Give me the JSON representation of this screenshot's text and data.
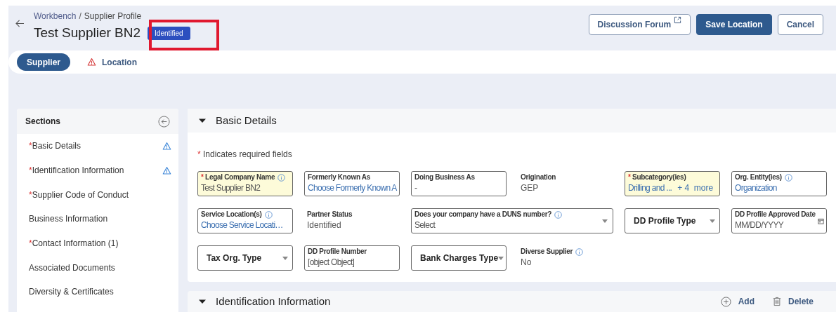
{
  "required_mark": "*",
  "breadcrumb_separator": "/",
  "breadcrumb": [
    {
      "label": "Workbench",
      "link": true
    },
    {
      "label": "Supplier Profile",
      "link": false
    }
  ],
  "title": "Test Supplier BN2",
  "status_badge": "Identified",
  "actions": [
    {
      "label": "Discussion Forum",
      "kind": "external"
    },
    {
      "label": "Save Location",
      "kind": "primary"
    },
    {
      "label": "Cancel",
      "kind": "secondary"
    }
  ],
  "tabs": [
    {
      "label": "Supplier",
      "selected": true,
      "warning": false
    },
    {
      "label": "Location",
      "selected": false,
      "warning": true
    }
  ],
  "sidebar": {
    "title": "Sections",
    "items": [
      {
        "label": "Basic Details",
        "required": true,
        "warning": true
      },
      {
        "label": "Identification Information",
        "required": true,
        "warning": true
      },
      {
        "label": "Supplier Code of Conduct",
        "required": true,
        "warning": false
      },
      {
        "label": "Business Information",
        "required": false,
        "warning": false
      },
      {
        "label": "Contact Information (1)",
        "required": true,
        "warning": false
      },
      {
        "label": "Associated Documents",
        "required": false,
        "warning": false
      },
      {
        "label": "Diversity & Certificates",
        "required": false,
        "warning": false
      }
    ]
  },
  "sections": [
    {
      "title": "Basic Details",
      "expanded": true,
      "required_note": "Indicates required fields",
      "rows": [
        [
          {
            "kind": "text",
            "label": "Legal Company Name",
            "value": "Test Supplier BN2",
            "required": true,
            "highlighted": true,
            "info": true
          },
          {
            "kind": "lookup",
            "label": "Formerly Known As",
            "value": "Choose Formerly Known A",
            "required": false,
            "highlighted": false,
            "info": false
          },
          {
            "kind": "text",
            "label": "Doing Business As",
            "value": "-",
            "required": false,
            "highlighted": false,
            "info": false
          },
          {
            "kind": "static",
            "label": "Origination",
            "value": "GEP",
            "required": false,
            "highlighted": false,
            "info": false
          },
          {
            "kind": "lookup",
            "label": "Subcategory(ies)",
            "value": "Drilling and ...",
            "extra": "+ 4  more",
            "required": true,
            "highlighted": true,
            "info": false
          },
          {
            "kind": "lookup",
            "label": "Org. Entity(ies)",
            "value": "Organization",
            "required": false,
            "highlighted": false,
            "info": true
          }
        ],
        [
          {
            "kind": "lookup",
            "label": "Service Location(s)",
            "value": "Choose Service Locati…",
            "required": false,
            "highlighted": false,
            "info": true
          },
          {
            "kind": "static",
            "label": "Partner Status",
            "value": "Identified",
            "required": false,
            "highlighted": false,
            "info": false
          },
          {
            "kind": "select",
            "label": "Does your company have a DUNS number?",
            "value": "Select",
            "required": false,
            "highlighted": false,
            "info": true,
            "colspan": 2
          },
          {
            "kind": "dropdown",
            "label": "DD Profile Type",
            "required": false,
            "highlighted": false,
            "info": false
          },
          {
            "kind": "date",
            "label": "DD Profile Approved Date",
            "value": "MM/DD/YYYY",
            "required": false,
            "highlighted": false,
            "info": false
          }
        ],
        [
          {
            "kind": "dropdown",
            "label": "Tax Org. Type",
            "required": false,
            "highlighted": false,
            "info": false
          },
          {
            "kind": "text",
            "label": "DD Profile Number",
            "value": "[object Object]",
            "required": false,
            "highlighted": false,
            "info": false
          },
          {
            "kind": "dropdown",
            "label": "Bank Charges Type",
            "required": false,
            "highlighted": false,
            "info": false
          },
          {
            "kind": "static",
            "label": "Diverse Supplier",
            "value": "No",
            "required": false,
            "highlighted": false,
            "info": true
          }
        ]
      ]
    },
    {
      "title": "Identification Information",
      "expanded": true,
      "tools": [
        {
          "label": "Add",
          "kind": "add"
        },
        {
          "label": "Delete",
          "kind": "delete"
        }
      ]
    }
  ]
}
